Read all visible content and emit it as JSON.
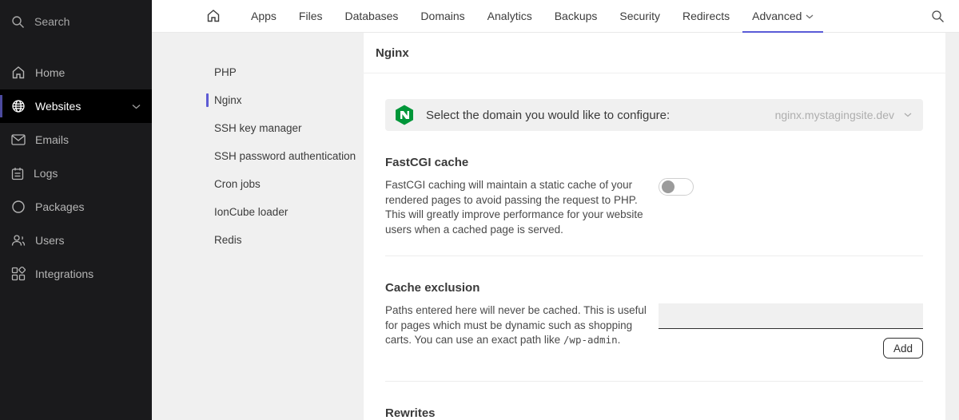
{
  "sidebar": {
    "search_label": "Search",
    "items": [
      {
        "label": "Home",
        "icon": "home-icon",
        "active": false
      },
      {
        "label": "Websites",
        "icon": "globe-icon",
        "active": true,
        "expandable": true
      },
      {
        "label": "Emails",
        "icon": "mail-icon",
        "active": false
      },
      {
        "label": "Logs",
        "icon": "logs-icon",
        "active": false
      },
      {
        "label": "Packages",
        "icon": "package-circle-icon",
        "active": false
      },
      {
        "label": "Users",
        "icon": "users-icon",
        "active": false
      },
      {
        "label": "Integrations",
        "icon": "integrations-grid-icon",
        "active": false
      }
    ]
  },
  "topnav": {
    "home_icon": "home-icon",
    "search_icon": "search-icon",
    "tabs": [
      "Apps",
      "Files",
      "Databases",
      "Domains",
      "Analytics",
      "Backups",
      "Security",
      "Redirects",
      "Advanced"
    ],
    "active_tab": "Advanced",
    "active_underline_color": "#5a5bd7"
  },
  "subnav": {
    "items": [
      "PHP",
      "Nginx",
      "SSH key manager",
      "SSH password authentication",
      "Cron jobs",
      "IonCube loader",
      "Redis"
    ],
    "active_item": "Nginx",
    "accent_color": "#5d5bd4"
  },
  "main": {
    "title": "Nginx",
    "domain_banner": {
      "icon": "nginx-logo-icon",
      "icon_color": "#009639",
      "label": "Select the domain you would like to configure:",
      "selected_domain": "nginx.mystagingsite.dev"
    },
    "fastcgi": {
      "heading": "FastCGI cache",
      "description": "FastCGI caching will maintain a static cache of your rendered pages to avoid passing the request to PHP. This will greatly improve performance for your website users when a cached page is served.",
      "toggle_state": "off"
    },
    "cache_exclusion": {
      "heading": "Cache exclusion",
      "description_text": "Paths entered here will never be cached. This is useful for pages which must be dynamic such as shopping carts. You can use an exact path like ",
      "path_example": "/wp-admin",
      "description_suffix": ".",
      "input_value": "",
      "add_button_label": "Add"
    },
    "rewrites": {
      "heading": "Rewrites"
    }
  }
}
